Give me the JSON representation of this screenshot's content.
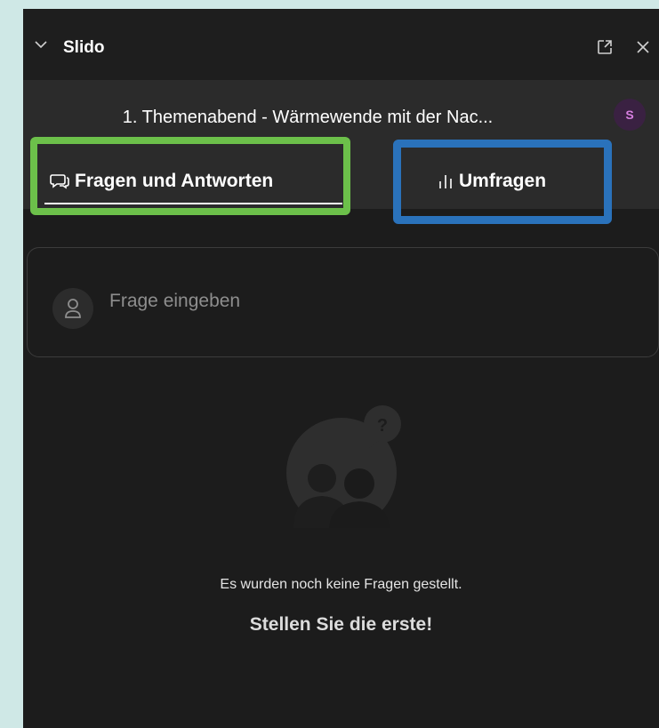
{
  "app": {
    "title": "Slido"
  },
  "event": {
    "title": "1. Themenabend - Wärmewende mit der Nac...",
    "avatar_initial": "S"
  },
  "tabs": [
    {
      "label": "Fragen und Antworten",
      "icon": "chat-bubbles-icon",
      "active": true
    },
    {
      "label": "Umfragen",
      "icon": "poll-bars-icon",
      "active": false
    }
  ],
  "question_input": {
    "placeholder": "Frage eingeben"
  },
  "empty_state": {
    "message": "Es wurden noch keine Fragen gestellt.",
    "cta": "Stellen Sie die erste!"
  },
  "colors": {
    "panel_bg": "#1c1c1c",
    "header_bg": "#2b2b2b",
    "highlight_green": "#6cc04a",
    "highlight_blue": "#2a72bb",
    "avatar_bg": "#3a2142",
    "avatar_text": "#d77fe0"
  }
}
